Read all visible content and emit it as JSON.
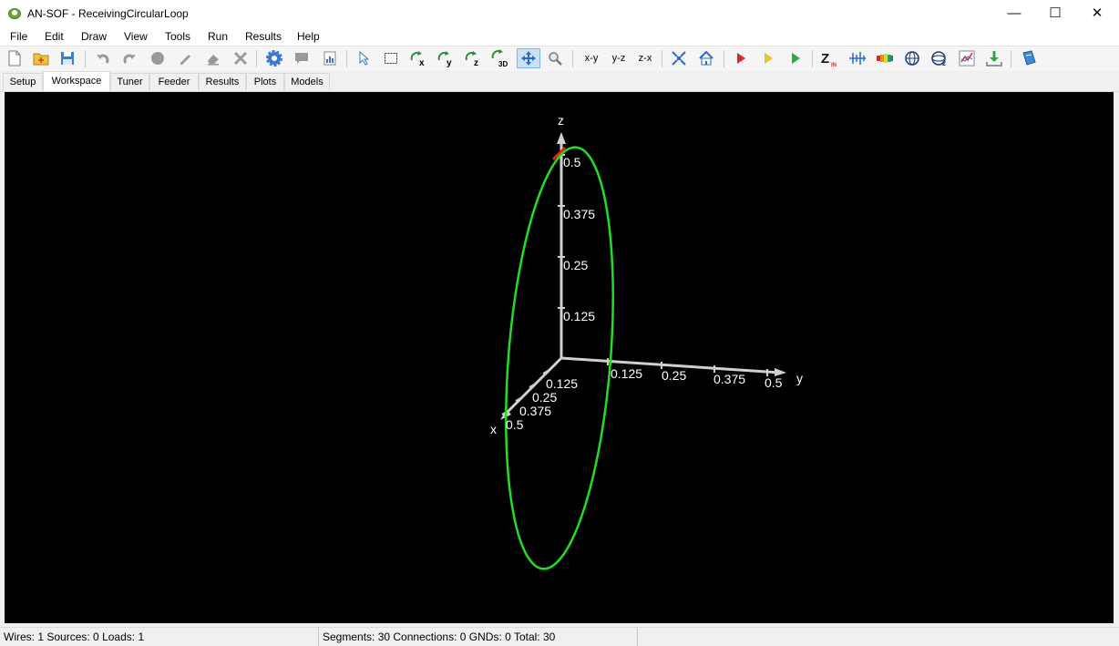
{
  "window": {
    "title": "AN-SOF - ReceivingCircularLoop",
    "controls": {
      "minimize": "—",
      "maximize": "☐",
      "close": "✕"
    }
  },
  "menu": [
    "File",
    "Edit",
    "Draw",
    "View",
    "Tools",
    "Run",
    "Results",
    "Help"
  ],
  "toolbar": {
    "new_icon": "new-file-icon",
    "open_icon": "open-folder-icon",
    "save_icon": "save-icon",
    "plane_xy": "x-y",
    "plane_yz": "y-z",
    "plane_zx": "z-x",
    "rot_x": "x",
    "rot_y": "y",
    "rot_z": "z",
    "rot_3d": "3D",
    "zin_label": "Z",
    "zin_sub": "IN",
    "colors": {
      "red_run": "#d42a2a",
      "yellow_run": "#e3c82a",
      "green_run": "#2aa84a"
    }
  },
  "tabs": [
    "Setup",
    "Workspace",
    "Tuner",
    "Feeder",
    "Results",
    "Plots",
    "Models"
  ],
  "active_tab": "Workspace",
  "viewport": {
    "axis_z": "z",
    "axis_y": "y",
    "axis_x": "x",
    "z_ticks": [
      "0.125",
      "0.25",
      "0.375",
      "0.5"
    ],
    "y_ticks": [
      "0.125",
      "0.25",
      "0.375",
      "0.5"
    ],
    "x_ticks": [
      "0.125",
      "0.25",
      "0.375",
      "0.5"
    ],
    "colors": {
      "background": "#000000",
      "axes": "#d0d0d0",
      "wire": "#22dd22",
      "load": "#ee2222"
    }
  },
  "status": {
    "wires": "Wires: 1",
    "sources": "Sources: 0",
    "loads": "Loads: 1",
    "segments": "Segments: 30",
    "connections": "Connections: 0",
    "gnds": "GNDs: 0",
    "total": "Total: 30"
  }
}
